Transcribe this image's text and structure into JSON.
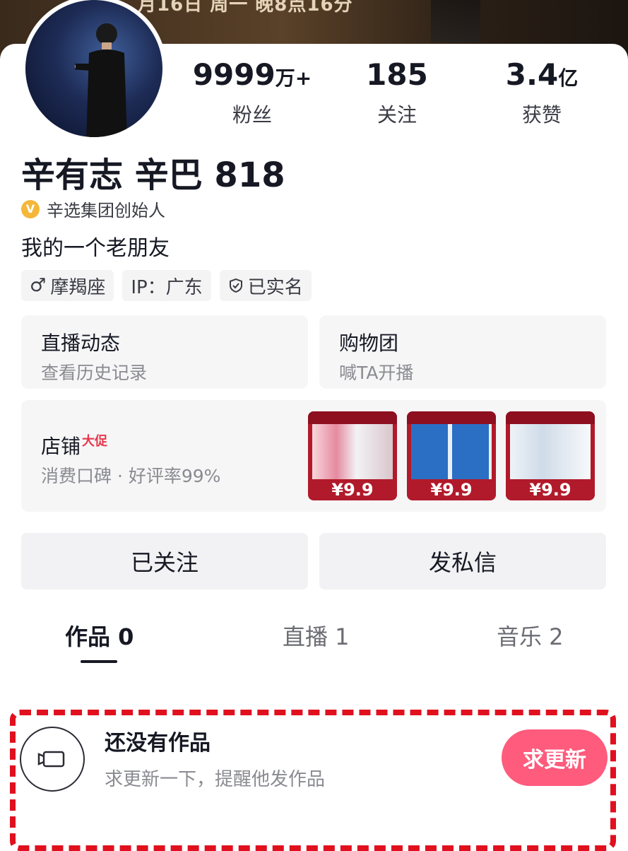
{
  "banner": {
    "text": "月16日 周一 晚8点16分"
  },
  "stats": [
    {
      "num": "9999",
      "unit": "万+",
      "label": "粉丝"
    },
    {
      "num": "185",
      "unit": "",
      "label": "关注"
    },
    {
      "num": "3.4",
      "unit": "亿",
      "label": "获赞"
    }
  ],
  "profile": {
    "name": "辛有志 辛巴 818",
    "verify_icon": "v-badge-icon",
    "verify_text": "辛选集团创始人",
    "bio": "我的一个老朋友",
    "tags": [
      "摩羯座",
      "IP：广东",
      "已实名"
    ]
  },
  "panels": {
    "live": {
      "title": "直播动态",
      "sub": "查看历史记录"
    },
    "group": {
      "title": "购物团",
      "sub": "喊TA开播"
    },
    "shop": {
      "title": "店铺",
      "badge": "大促",
      "sub": "消费口碑 · 好评率99%"
    }
  },
  "products": [
    {
      "price": "¥9.9"
    },
    {
      "price": "¥9.9"
    },
    {
      "price": "¥9.9"
    }
  ],
  "buttons": {
    "follow": "已关注",
    "message": "发私信"
  },
  "tabs": [
    "作品 0",
    "直播 1",
    "音乐 2"
  ],
  "empty": {
    "title": "还没有作品",
    "sub": "求更新一下，提醒他发作品",
    "cta": "求更新"
  },
  "colors": {
    "accent": "#fe4a6f",
    "dash": "#e0101e",
    "verify": "#f4b73a"
  }
}
